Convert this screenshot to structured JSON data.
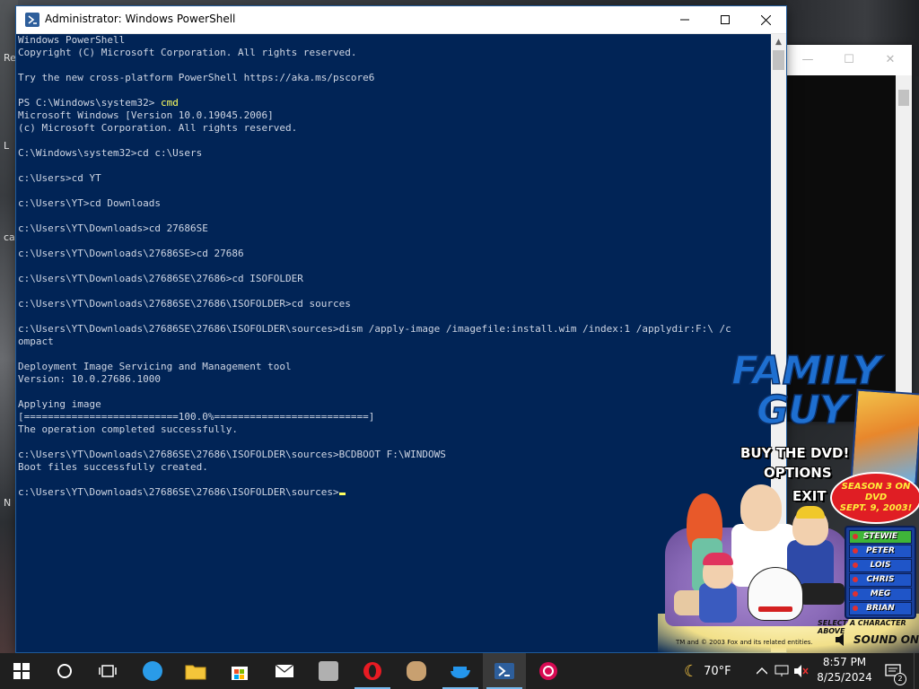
{
  "desktop": {
    "left_labels": [
      "Re",
      "L",
      "cal",
      "N"
    ]
  },
  "bg_window": {
    "minimize": "—",
    "maximize": "☐",
    "close": "✕"
  },
  "window": {
    "title": "Administrator: Windows PowerShell",
    "accent": "#012456"
  },
  "console": {
    "lines": [
      "Windows PowerShell",
      "Copyright (C) Microsoft Corporation. All rights reserved.",
      "",
      "Try the new cross-platform PowerShell https://aka.ms/pscore6",
      "",
      "PS C:\\Windows\\system32> ",
      "Microsoft Windows [Version 10.0.19045.2006]",
      "(c) Microsoft Corporation. All rights reserved.",
      "",
      "C:\\Windows\\system32>cd c:\\Users",
      "",
      "c:\\Users>cd YT",
      "",
      "c:\\Users\\YT>cd Downloads",
      "",
      "c:\\Users\\YT\\Downloads>cd 27686SE",
      "",
      "c:\\Users\\YT\\Downloads\\27686SE>cd 27686",
      "",
      "c:\\Users\\YT\\Downloads\\27686SE\\27686>cd ISOFOLDER",
      "",
      "c:\\Users\\YT\\Downloads\\27686SE\\27686\\ISOFOLDER>cd sources",
      "",
      "c:\\Users\\YT\\Downloads\\27686SE\\27686\\ISOFOLDER\\sources>dism /apply-image /imagefile:install.wim /index:1 /applydir:F:\\ /c",
      "ompact",
      "",
      "Deployment Image Servicing and Management tool",
      "Version: 10.0.27686.1000",
      "",
      "Applying image",
      "[==========================100.0%==========================]",
      "The operation completed successfully.",
      "",
      "c:\\Users\\YT\\Downloads\\27686SE\\27686\\ISOFOLDER\\sources>BCDBOOT F:\\WINDOWS",
      "Boot files successfully created.",
      "",
      "c:\\Users\\YT\\Downloads\\27686SE\\27686\\ISOFOLDER\\sources>"
    ],
    "ps_cmd": "cmd",
    "progress_percent": 100.0
  },
  "family_guy": {
    "logo_line1": "FAMILY",
    "logo_line2": "GUY",
    "buy": "BUY THE DVD!",
    "options": "OPTIONS",
    "exit": "EXIT",
    "season_line1": "SEASON 3 ON DVD",
    "season_line2": "SEPT. 9, 2003!",
    "characters": [
      "STEWIE",
      "PETER",
      "LOIS",
      "CHRIS",
      "MEG",
      "BRIAN"
    ],
    "selected_character": "STEWIE",
    "select_hint": "SELECT A CHARACTER ABOVE",
    "copyright": "TM and © 2003 Fox and its related entities.",
    "sound": "SOUND ON"
  },
  "taskbar": {
    "weather_temp": "70°F",
    "time": "8:57 PM",
    "date": "8/25/2024",
    "notification_count": "2",
    "items": [
      {
        "name": "start-button",
        "color": "#ffffff"
      },
      {
        "name": "search-button",
        "color": "#ffffff"
      },
      {
        "name": "task-view-button",
        "color": "#ffffff"
      },
      {
        "name": "app-blue-circle",
        "color": "#2a9be8"
      },
      {
        "name": "file-explorer",
        "color": "#f4c53a"
      },
      {
        "name": "microsoft-store",
        "color": "#f25022"
      },
      {
        "name": "mail",
        "color": "#e8e8e8"
      },
      {
        "name": "app-gray-box",
        "color": "#b0b0b0"
      },
      {
        "name": "opera",
        "color": "#e81b23"
      },
      {
        "name": "app-family-guy",
        "color": "#c8a070"
      },
      {
        "name": "docker",
        "color": "#2496ed"
      },
      {
        "name": "powershell",
        "color": "#2d5e9b"
      },
      {
        "name": "debian",
        "color": "#d70a53"
      }
    ]
  }
}
